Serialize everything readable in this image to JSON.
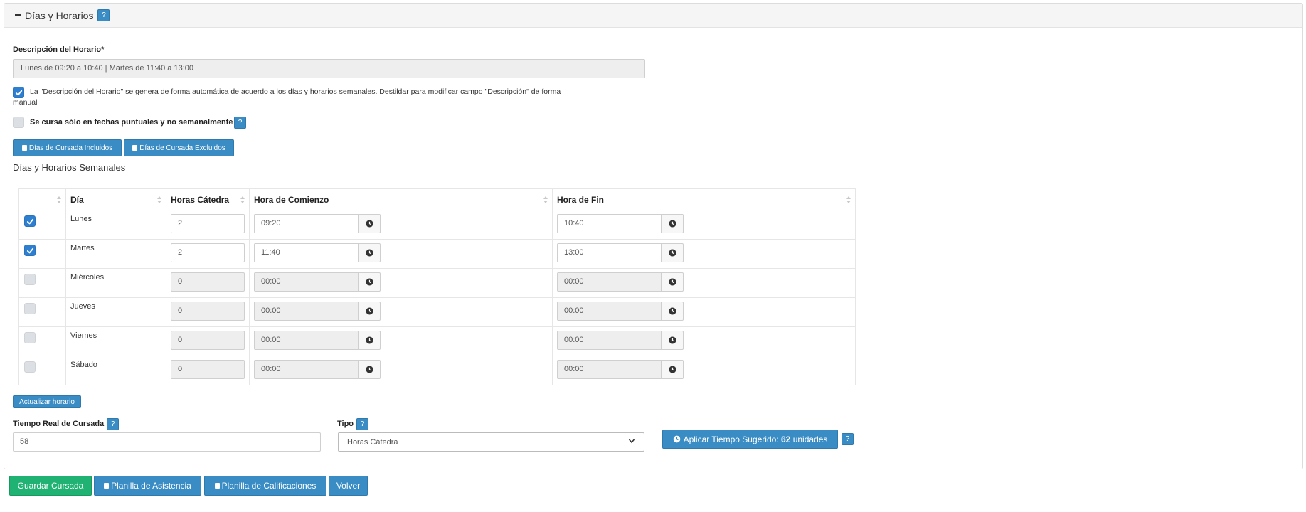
{
  "panel": {
    "title": "Días y Horarios",
    "help": "?"
  },
  "description": {
    "label": "Descripción del Horario*",
    "value": "Lunes de 09:20 a 10:40 | Martes de 11:40 a 13:00"
  },
  "auto_note": {
    "line1": "La \"Descripción del Horario\" se genera de forma automática de acuerdo a los días y horarios semanales. Destildar para modificar campo \"Descripción\" de forma",
    "line2": "manual",
    "checked": true
  },
  "puntuales": {
    "label": "Se cursa sólo en fechas puntuales y no semanalmente",
    "help": "?",
    "checked": false
  },
  "buttons": {
    "incluidos": "Días de Cursada Incluidos",
    "excluidos": "Días de Cursada Excluidos",
    "actualizar": "Actualizar horario",
    "guardar": "Guardar Cursada",
    "asistencia": "Planilla de Asistencia",
    "calificaciones": "Planilla de Calificaciones",
    "volver": "Volver"
  },
  "weekly": {
    "title": "Días y Horarios Semanales",
    "columns": [
      "",
      "Día",
      "Horas Cátedra",
      "Hora de Comienzo",
      "Hora de Fin"
    ],
    "rows": [
      {
        "day": "Lunes",
        "checked": true,
        "hours": "2",
        "start": "09:20",
        "end": "10:40"
      },
      {
        "day": "Martes",
        "checked": true,
        "hours": "2",
        "start": "11:40",
        "end": "13:00"
      },
      {
        "day": "Miércoles",
        "checked": false,
        "hours": "0",
        "start": "00:00",
        "end": "00:00"
      },
      {
        "day": "Jueves",
        "checked": false,
        "hours": "0",
        "start": "00:00",
        "end": "00:00"
      },
      {
        "day": "Viernes",
        "checked": false,
        "hours": "0",
        "start": "00:00",
        "end": "00:00"
      },
      {
        "day": "Sábado",
        "checked": false,
        "hours": "0",
        "start": "00:00",
        "end": "00:00"
      }
    ]
  },
  "tiempo": {
    "label": "Tiempo Real de Cursada",
    "help": "?",
    "value": "58"
  },
  "tipo": {
    "label": "Tipo",
    "help": "?",
    "selected": "Horas Cátedra"
  },
  "sugerido": {
    "prefix": "Aplicar Tiempo Sugerido:",
    "value": "62",
    "suffix": "unidades",
    "help": "?"
  },
  "colors": {
    "primary": "#3a8cc4",
    "success": "#1fb272",
    "checkbox": "#2f7fd0"
  }
}
